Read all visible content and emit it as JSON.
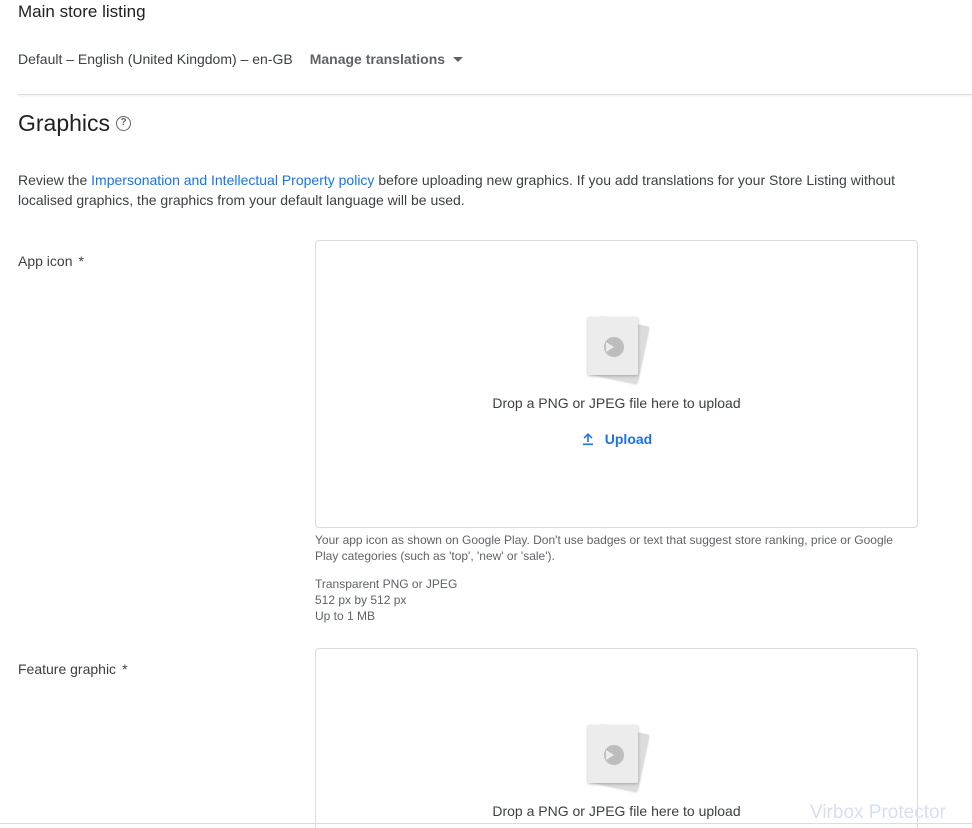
{
  "header": {
    "title": "Main store listing",
    "language": "Default – English (United Kingdom) – en-GB",
    "manage_translations": "Manage translations"
  },
  "graphics": {
    "title": "Graphics",
    "help_glyph": "?",
    "intro_before": "Review the ",
    "intro_link": "Impersonation and Intellectual Property policy",
    "intro_after": " before uploading new graphics. If you add translations for your Store Listing without localised graphics, the graphics from your default language will be used."
  },
  "app_icon": {
    "label": "App icon",
    "required_mark": "*",
    "drop_text": "Drop a PNG or JPEG file here to upload",
    "upload_label": "Upload",
    "description": "Your app icon as shown on Google Play. Don't use badges or text that suggest store ranking, price or Google Play categories (such as 'top', 'new' or 'sale').",
    "specs": [
      "Transparent PNG or JPEG",
      "512 px by 512 px",
      "Up to 1 MB"
    ]
  },
  "feature_graphic": {
    "label": "Feature graphic",
    "required_mark": "*",
    "drop_text": "Drop a PNG or JPEG file here to upload"
  },
  "watermark": "Virbox Protector",
  "icons": {
    "help": "help-circle-icon",
    "caret": "caret-down-icon",
    "upload": "upload-icon",
    "file": "image-file-icon"
  },
  "colors": {
    "link": "#1a73e8",
    "text": "#3c4043",
    "border": "#dadce0"
  }
}
